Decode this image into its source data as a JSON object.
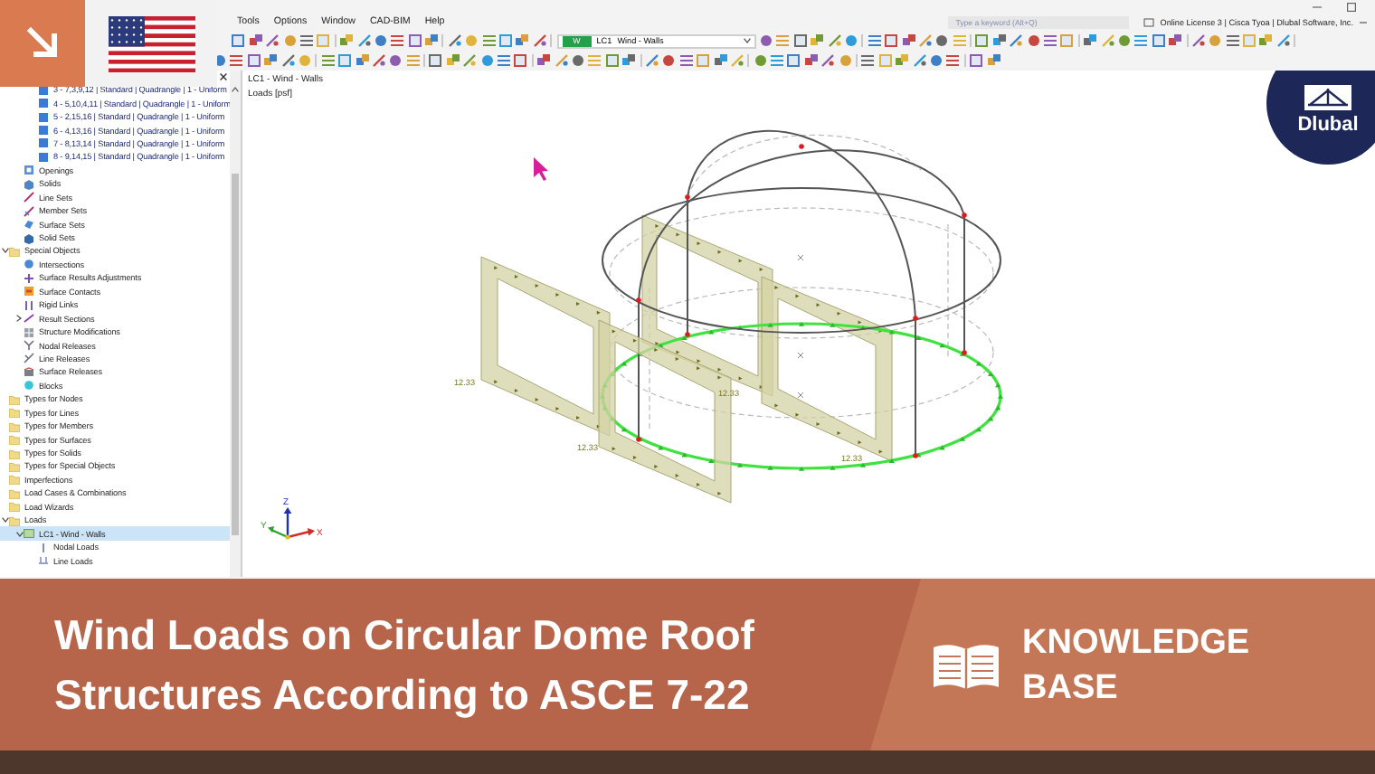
{
  "window": {
    "license": "Online License 3 | Cisca Tyoa | Dlubal Software, Inc."
  },
  "menu": [
    "Tools",
    "Options",
    "Window",
    "CAD-BIM",
    "Help"
  ],
  "search": {
    "placeholder": "Type a keyword (Alt+Q)"
  },
  "load_case_selector": {
    "badge": "W",
    "number": "LC1",
    "name": "Wind - Walls"
  },
  "navigator": {
    "surface_loads": [
      {
        "label": "3 - 7,3,9,12 | Standard | Quadrangle | 1 - Uniform",
        "kind": "surface-load",
        "selected": false
      },
      {
        "label": "4 - 5,10,4,11 | Standard | Quadrangle | 1 - Uniform",
        "kind": "surface-load",
        "selected": false
      },
      {
        "label": "5 - 2,15,16 | Standard | Quadrangle | 1 - Uniform",
        "kind": "surface-load",
        "selected": false
      },
      {
        "label": "6 - 4,13,16 | Standard | Quadrangle | 1 - Uniform",
        "kind": "surface-load",
        "selected": false
      },
      {
        "label": "7 - 8,13,14 | Standard | Quadrangle | 1 - Uniform",
        "kind": "surface-load",
        "selected": false
      },
      {
        "label": "8 - 9,14,15 | Standard | Quadrangle | 1 - Uniform",
        "kind": "surface-load",
        "selected": false
      }
    ],
    "model_items": [
      {
        "label": "Openings",
        "kind": "opening",
        "selected": false
      },
      {
        "label": "Solids",
        "kind": "solid",
        "selected": false
      },
      {
        "label": "Line Sets",
        "kind": "line-set",
        "selected": false
      },
      {
        "label": "Member Sets",
        "kind": "member-set",
        "selected": false
      },
      {
        "label": "Surface Sets",
        "kind": "surface-set",
        "selected": false
      },
      {
        "label": "Solid Sets",
        "kind": "solid-set",
        "selected": false
      }
    ],
    "tree": [
      {
        "label": "Special Objects",
        "kind": "folder",
        "selected": false,
        "expanded": true,
        "children": [
          {
            "label": "Intersections",
            "kind": "intersection",
            "selected": false
          },
          {
            "label": "Surface Results Adjustments",
            "kind": "adjustment",
            "selected": false
          },
          {
            "label": "Surface Contacts",
            "kind": "contact",
            "selected": false
          },
          {
            "label": "Rigid Links",
            "kind": "rigid-link",
            "selected": false
          },
          {
            "label": "Result Sections",
            "kind": "result-section",
            "selected": false,
            "expanded": false
          },
          {
            "label": "Structure Modifications",
            "kind": "modification",
            "selected": false
          },
          {
            "label": "Nodal Releases",
            "kind": "nodal-release",
            "selected": false
          },
          {
            "label": "Line Releases",
            "kind": "line-release",
            "selected": false
          },
          {
            "label": "Surface Releases",
            "kind": "surface-release",
            "selected": false
          },
          {
            "label": "Blocks",
            "kind": "block",
            "selected": false
          }
        ]
      },
      {
        "label": "Types for Nodes",
        "kind": "folder",
        "selected": false
      },
      {
        "label": "Types for Lines",
        "kind": "folder",
        "selected": false
      },
      {
        "label": "Types for Members",
        "kind": "folder",
        "selected": false
      },
      {
        "label": "Types for Surfaces",
        "kind": "folder",
        "selected": false
      },
      {
        "label": "Types for Solids",
        "kind": "folder",
        "selected": false
      },
      {
        "label": "Types for Special Objects",
        "kind": "folder",
        "selected": false
      },
      {
        "label": "Imperfections",
        "kind": "folder",
        "selected": false
      },
      {
        "label": "Load Cases & Combinations",
        "kind": "folder",
        "selected": false
      },
      {
        "label": "Load Wizards",
        "kind": "folder",
        "selected": false
      },
      {
        "label": "Loads",
        "kind": "folder",
        "selected": false,
        "expanded": true,
        "children": [
          {
            "label": "LC1 - Wind - Walls",
            "kind": "load-case",
            "selected": true,
            "expanded": true,
            "children": [
              {
                "label": "Nodal Loads",
                "kind": "nodal-load",
                "selected": false
              },
              {
                "label": "Line Loads",
                "kind": "line-load",
                "selected": false
              }
            ]
          }
        ]
      }
    ]
  },
  "viewport": {
    "title": "LC1 - Wind - Walls",
    "units": "Loads [psf]",
    "load_labels": [
      "12.33",
      "12.33",
      "12.33",
      "12.33"
    ],
    "axes": [
      "Z",
      "Y",
      "X"
    ]
  },
  "logo": {
    "text": "Dlubal"
  },
  "banner": {
    "title": "Wind Loads on Circular Dome Roof Structures According to ASCE 7-22",
    "category": "KNOWLEDGE BASE"
  }
}
